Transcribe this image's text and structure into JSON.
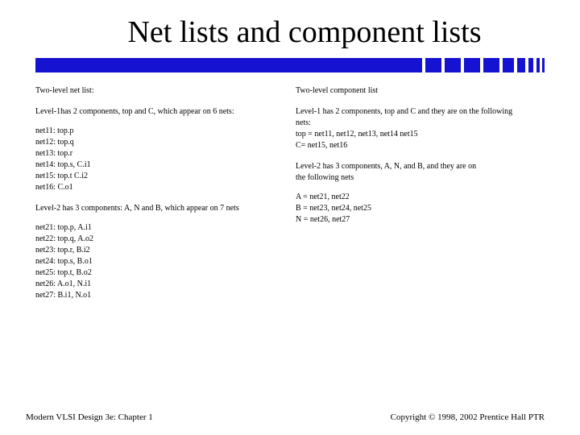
{
  "title": "Net lists and component lists",
  "left": {
    "header": "Two-level net list:",
    "l1_intro": "Level-1has 2 components, top and C, which appear on 6 nets:",
    "l1_nets": [
      "net11: top.p",
      "net12: top.q",
      "net13: top.r",
      "net14: top.s, C.i1",
      "net15: top.t C.i2",
      "net16: C.o1"
    ],
    "l2_intro": "Level-2 has 3 components: A, N and B, which appear on 7 nets",
    "l2_nets": [
      "net21: top.p, A.i1",
      "net22: top.q, A.o2",
      "net23: top.r, B.i2",
      "net24: top.s, B.o1",
      "net25: top.t, B.o2",
      "net26: A.o1, N.i1",
      "net27: B.i1, N.o1"
    ]
  },
  "right": {
    "header": "Two-level component list",
    "l1_intro_a": "Level-1 has 2 components, top and C and they are on the following",
    "l1_intro_b": "nets:",
    "l1_comp": [
      "top = net11, net12, net13, net14 net15",
      "C= net15, net16"
    ],
    "l2_intro_a": "Level-2 has 3 components, A, N, and B, and they are on",
    "l2_intro_b": "the following nets",
    "l2_comp": [
      "A = net21, net22",
      "B = net23, net24, net25",
      "N = net26, net27"
    ]
  },
  "footer_left": "Modern VLSI Design 3e: Chapter 1",
  "footer_right": "Copyright © 1998, 2002 Prentice Hall PTR"
}
